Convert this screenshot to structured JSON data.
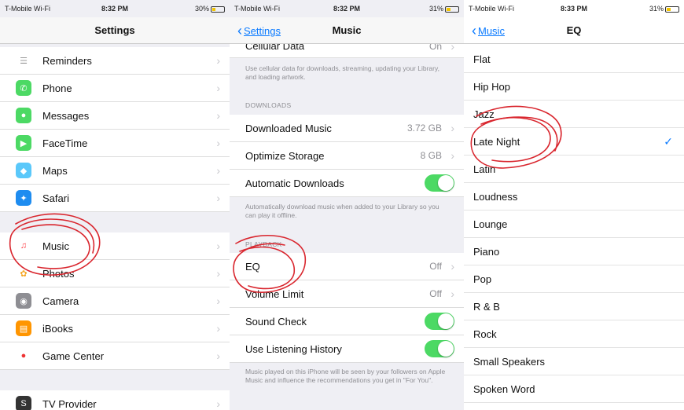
{
  "colors": {
    "link": "#0a7aff",
    "toggle_on": "#4cd964",
    "annotation": "#d9262e"
  },
  "status_bars": [
    {
      "carrier": "T-Mobile Wi-Fi",
      "time": "8:32 PM",
      "battery": "30%"
    },
    {
      "carrier": "T-Mobile Wi-Fi",
      "time": "8:32 PM",
      "battery": "31%"
    },
    {
      "carrier": "T-Mobile Wi-Fi",
      "time": "8:33 PM",
      "battery": "31%"
    }
  ],
  "settings": {
    "title": "Settings",
    "items": [
      {
        "label": "Reminders",
        "icon": "list-icon",
        "color": "#ffffff"
      },
      {
        "label": "Phone",
        "icon": "phone-icon",
        "color": "#4cd964"
      },
      {
        "label": "Messages",
        "icon": "message-bubble-icon",
        "color": "#4cd964"
      },
      {
        "label": "FaceTime",
        "icon": "video-camera-icon",
        "color": "#4cd964"
      },
      {
        "label": "Maps",
        "icon": "map-icon",
        "color": "#5ac8fa"
      },
      {
        "label": "Safari",
        "icon": "compass-icon",
        "color": "#1e8cf0"
      },
      {
        "label": "Music",
        "icon": "music-note-icon",
        "color": "#ffffff"
      },
      {
        "label": "Photos",
        "icon": "photos-flower-icon",
        "color": "#ffffff"
      },
      {
        "label": "Camera",
        "icon": "camera-icon",
        "color": "#8e8e93"
      },
      {
        "label": "iBooks",
        "icon": "book-icon",
        "color": "#ff9500"
      },
      {
        "label": "Game Center",
        "icon": "game-bubbles-icon",
        "color": "#ffffff"
      },
      {
        "label": "TV Provider",
        "icon": "tv-provider-icon",
        "color": "#333333"
      }
    ]
  },
  "music": {
    "back_label": "Settings",
    "title": "Music",
    "cellular_label": "Cellular Data",
    "cellular_value": "On",
    "cellular_note": "Use cellular data for downloads, streaming, updating your Library, and loading artwork.",
    "downloads_header": "DOWNLOADS",
    "downloaded_music_label": "Downloaded Music",
    "downloaded_music_value": "3.72 GB",
    "optimize_label": "Optimize Storage",
    "optimize_value": "8 GB",
    "auto_label": "Automatic Downloads",
    "auto_note": "Automatically download music when added to your Library so you can play it offline.",
    "playback_header": "PLAYBACK",
    "eq_label": "EQ",
    "eq_value": "Off",
    "volume_label": "Volume Limit",
    "volume_value": "Off",
    "sound_check_label": "Sound Check",
    "history_label": "Use Listening History",
    "history_note": "Music played on this iPhone will be seen by your followers on Apple Music and influence the recommendations you get in \"For You\"."
  },
  "eq": {
    "back_label": "Music",
    "title": "EQ",
    "options": [
      "Flat",
      "Hip Hop",
      "Jazz",
      "Late Night",
      "Latin",
      "Loudness",
      "Lounge",
      "Piano",
      "Pop",
      "R & B",
      "Rock",
      "Small Speakers",
      "Spoken Word"
    ],
    "selected": "Late Night"
  }
}
